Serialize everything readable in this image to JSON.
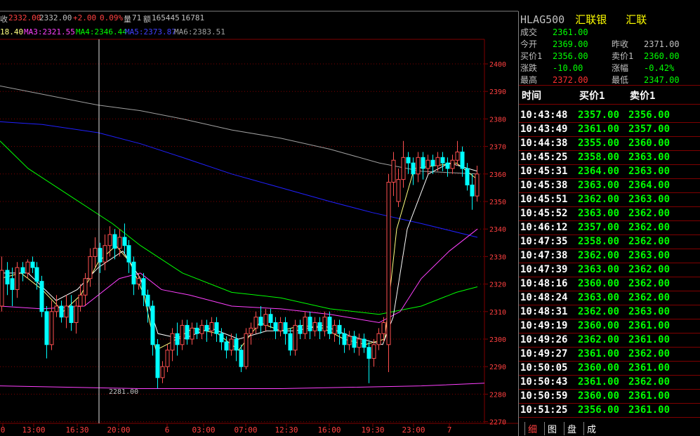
{
  "header": {
    "prev_close_label": "收",
    "prev_close_value": "2332.00",
    "last_value": "2332.00",
    "change": "+2.00",
    "change_pct": "0.09%",
    "volume_label": "量",
    "volume_value": "71",
    "amount_label": "额",
    "amount_value": "165445",
    "extra_value": "16781"
  },
  "ma_bar": {
    "ma1": "18.40",
    "ma3": "MA3:2321.55",
    "ma4": "MA4:2346.44",
    "ma5": "MA5:2373.87",
    "ma6": "MA6:2383.51"
  },
  "colors": {
    "up": "#ff5050",
    "down": "#00ffff",
    "grid": "#800000",
    "ma1": "#ffff80",
    "ma3": "#ff40ff",
    "ma4": "#00ff00",
    "ma5": "#2020ff",
    "ma6": "#a0a0a0",
    "axis_text": "#ff4040",
    "quote_green": "#00ff00",
    "quote_red": "#ff3030"
  },
  "chart_data": {
    "type": "candlestick",
    "y_ticks": [
      "2400",
      "2390",
      "2380",
      "2370",
      "2360",
      "2350",
      "2340",
      "2330",
      "2320",
      "2310",
      "2300",
      "2290",
      "2280",
      "2270"
    ],
    "x_ticks": [
      "0",
      "13:00",
      "16:30",
      "20:00",
      "6",
      "03:00",
      "07:00",
      "12:30",
      "16:00",
      "19:30",
      "23:00",
      "7"
    ],
    "ylim": [
      2270,
      2405
    ],
    "annotation": "2281.00",
    "crosshair_label": "20:00"
  },
  "quote": {
    "symbol": "HLAG500",
    "name1": "汇联银",
    "name2": "汇联",
    "rows": [
      {
        "l1": "成交",
        "v1": "2361.00",
        "l2": "",
        "v2": ""
      },
      {
        "l1": "今开",
        "v1": "2369.00",
        "l2": "昨收",
        "v2": "2371.00"
      },
      {
        "l1": "买价1",
        "v1": "2356.00",
        "l2": "卖价1",
        "v2": "2360.00"
      },
      {
        "l1": "涨跌",
        "v1": "-10.00",
        "l2": "涨幅",
        "v2": "-0.42%"
      },
      {
        "l1": "最高",
        "v1": "2372.00",
        "l2": "最低",
        "v2": "2347.00"
      }
    ]
  },
  "ticks": {
    "headers": [
      "时间",
      "买价1",
      "卖价1"
    ],
    "rows": [
      [
        "10:43:48",
        "2357.00",
        "2356.00"
      ],
      [
        "10:43:49",
        "2361.00",
        "2357.00"
      ],
      [
        "10:44:38",
        "2355.00",
        "2360.00"
      ],
      [
        "10:45:25",
        "2358.00",
        "2363.00"
      ],
      [
        "10:45:31",
        "2364.00",
        "2363.00"
      ],
      [
        "10:45:38",
        "2363.00",
        "2364.00"
      ],
      [
        "10:45:51",
        "2362.00",
        "2363.00"
      ],
      [
        "10:45:52",
        "2363.00",
        "2362.00"
      ],
      [
        "10:46:12",
        "2357.00",
        "2362.00"
      ],
      [
        "10:47:35",
        "2358.00",
        "2362.00"
      ],
      [
        "10:47:38",
        "2362.00",
        "2363.00"
      ],
      [
        "10:47:39",
        "2363.00",
        "2362.00"
      ],
      [
        "10:48:16",
        "2360.00",
        "2362.00"
      ],
      [
        "10:48:24",
        "2363.00",
        "2362.00"
      ],
      [
        "10:48:31",
        "2362.00",
        "2363.00"
      ],
      [
        "10:49:19",
        "2360.00",
        "2361.00"
      ],
      [
        "10:49:26",
        "2362.00",
        "2361.00"
      ],
      [
        "10:49:27",
        "2361.00",
        "2362.00"
      ],
      [
        "10:50:05",
        "2360.00",
        "2361.00"
      ],
      [
        "10:50:43",
        "2361.00",
        "2362.00"
      ],
      [
        "10:50:59",
        "2360.00",
        "2361.00"
      ],
      [
        "10:51:25",
        "2356.00",
        "2361.00"
      ]
    ]
  },
  "tabs": [
    "细",
    "图",
    "盘",
    "成"
  ]
}
